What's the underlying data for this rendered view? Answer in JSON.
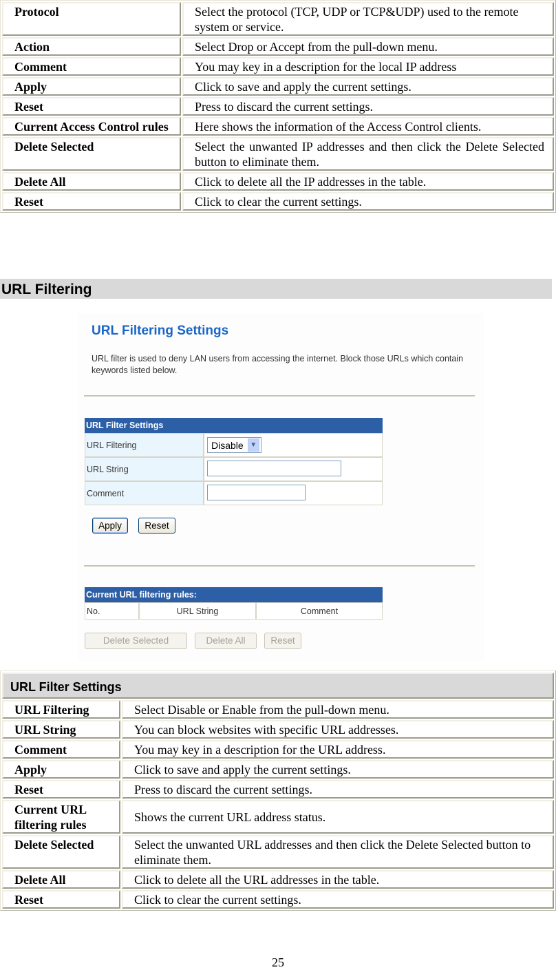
{
  "access_control_table": {
    "rows": [
      {
        "term": "Protocol",
        "desc": "Select the protocol (TCP, UDP or TCP&UDP) used to the remote system or service."
      },
      {
        "term": "Action",
        "desc": "Select Drop or Accept from the pull-down menu."
      },
      {
        "term": "Comment",
        "desc": "You may key in a description for the local IP address"
      },
      {
        "term": "Apply",
        "desc": "Click to save and apply the current settings."
      },
      {
        "term": "Reset",
        "desc": "Press to discard the current settings."
      },
      {
        "term": "Current Access Control rules",
        "desc": "Here shows the information of the Access Control clients."
      },
      {
        "term": "Delete Selected",
        "desc": "Select the unwanted IP addresses and then click the Delete Selected button to eliminate them."
      },
      {
        "term": "Delete All",
        "desc": "Click to delete all the IP addresses in the table."
      },
      {
        "term": "Reset",
        "desc": "Click to clear the current settings."
      }
    ]
  },
  "section": {
    "title": "URL Filtering"
  },
  "screenshot": {
    "title": "URL Filtering Settings",
    "description": "URL filter is used to deny LAN users from accessing the internet. Block those URLs which contain keywords listed below.",
    "form": {
      "header": "URL Filter Settings",
      "url_filtering_label": "URL Filtering",
      "url_filtering_value": "Disable",
      "url_string_label": "URL String",
      "url_string_value": "",
      "comment_label": "Comment",
      "comment_value": "",
      "apply_label": "Apply",
      "reset_label": "Reset"
    },
    "rules": {
      "header": "Current URL filtering rules:",
      "columns": [
        "No.",
        "URL String",
        "Comment"
      ],
      "delete_selected_label": "Delete Selected",
      "delete_all_label": "Delete All",
      "reset_label": "Reset"
    }
  },
  "url_filter_table": {
    "header": "URL Filter Settings",
    "rows": [
      {
        "term": "URL Filtering",
        "desc": "Select Disable or Enable from the pull-down menu."
      },
      {
        "term": "URL String",
        "desc": "You can block websites with specific URL addresses."
      },
      {
        "term": "Comment",
        "desc": "You may key in a description for the URL address."
      },
      {
        "term": "Apply",
        "desc": "Click to save and apply the current settings."
      },
      {
        "term": "Reset",
        "desc": "Press to discard the current settings."
      },
      {
        "term": "Current URL filtering rules",
        "desc": "Shows the current URL address status."
      },
      {
        "term": "Delete Selected",
        "desc": "Select the unwanted URL addresses and then click the Delete Selected button to eliminate them."
      },
      {
        "term": "Delete All",
        "desc": "Click to delete all the URL addresses in the table."
      },
      {
        "term": "Reset",
        "desc": "Click to clear the current settings."
      }
    ]
  },
  "page_number": "25"
}
